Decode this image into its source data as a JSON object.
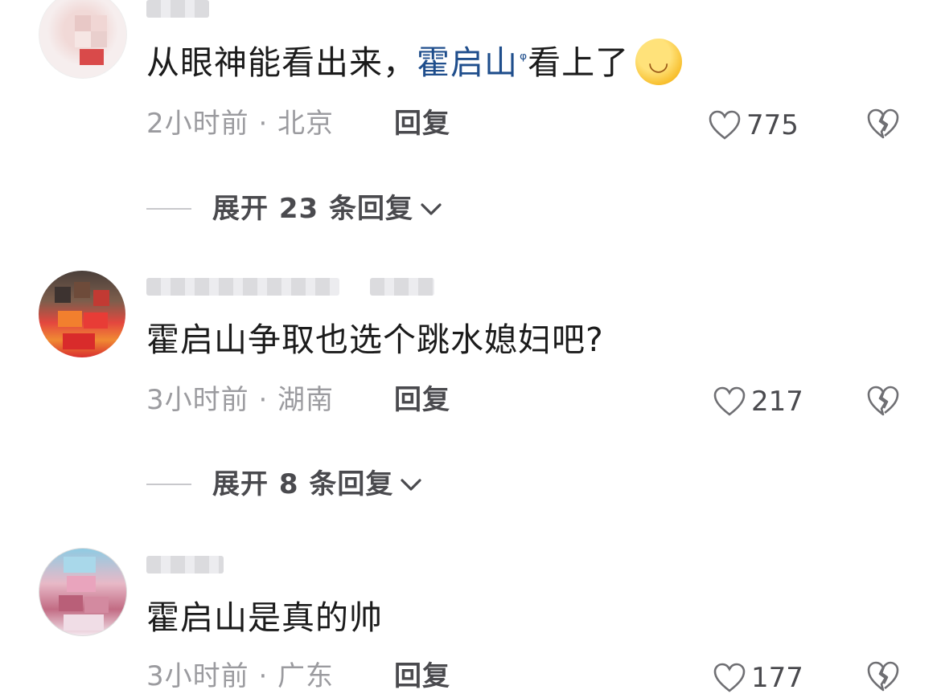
{
  "comments": [
    {
      "text_before": "从眼神能看出来，",
      "link_text": "霍启山",
      "search_icon": "search-icon",
      "text_after": "看上了",
      "emoji": "😊",
      "meta": "2小时前 · 北京",
      "reply_label": "回复",
      "likes": "775",
      "expand_label": "展开 23 条回复"
    },
    {
      "text": "霍启山争取也选个跳水媳妇吧?",
      "meta": "3小时前 · 湖南",
      "reply_label": "回复",
      "likes": "217",
      "expand_label": "展开 8 条回复"
    },
    {
      "text": "霍启山是真的帅",
      "meta": "3小时前 · 广东",
      "reply_label": "回复",
      "likes": "177"
    }
  ],
  "colors": {
    "link": "#1f4e8c",
    "meta": "#9b9b9f",
    "action": "#4a4a4e"
  }
}
